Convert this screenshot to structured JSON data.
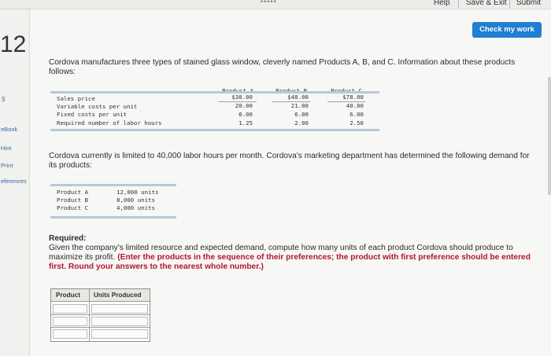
{
  "topbar": {
    "help": "Help",
    "save_exit": "Save & Exit",
    "submit": "Submit",
    "dots": "•••••"
  },
  "check_button": "Check my work",
  "sidebar": {
    "question_number": "12",
    "dollar": "$",
    "ebook": "eBook",
    "hint": "Hint",
    "print": "Print",
    "references": "eferences"
  },
  "intro": "Cordova manufactures three types of stained glass window, cleverly named Products A, B, and C. Information about these products follows:",
  "product_table": {
    "columns": [
      "Product A",
      "Product B",
      "Product C"
    ],
    "rows": [
      {
        "label": "Sales price",
        "values": [
          "$38.00",
          "$48.00",
          "$78.00"
        ]
      },
      {
        "label": "Variable costs per unit",
        "values": [
          "20.00",
          "21.00",
          "40.00"
        ]
      },
      {
        "label": "Fixed costs per unit",
        "values": [
          "6.00",
          "6.00",
          "6.00"
        ]
      },
      {
        "label": "Required number of labor hours",
        "values": [
          "1.25",
          "2.00",
          "2.50"
        ]
      }
    ]
  },
  "para2": "Cordova currently is limited to 40,000 labor hours per month. Cordova's marketing department has determined the following demand for its products:",
  "demand_table": [
    {
      "product": "Product A",
      "units": "12,000 units"
    },
    {
      "product": "Product B",
      "units": "8,000 units"
    },
    {
      "product": "Product C",
      "units": "4,000 units"
    }
  ],
  "required": {
    "title": "Required:",
    "text": "Given the company's limited resource and expected demand, compute how many units of each product Cordova should produce to maximize its profit.",
    "instruction": "(Enter the products in the sequence of their preferences; the product with first preference should be entered first. Round your answers to the nearest whole number.)"
  },
  "answer_table": {
    "col1": "Product",
    "col2": "Units Produced",
    "rows": 3
  },
  "colors": {
    "accent": "#1f7fd1",
    "instruction": "#b0172c"
  }
}
